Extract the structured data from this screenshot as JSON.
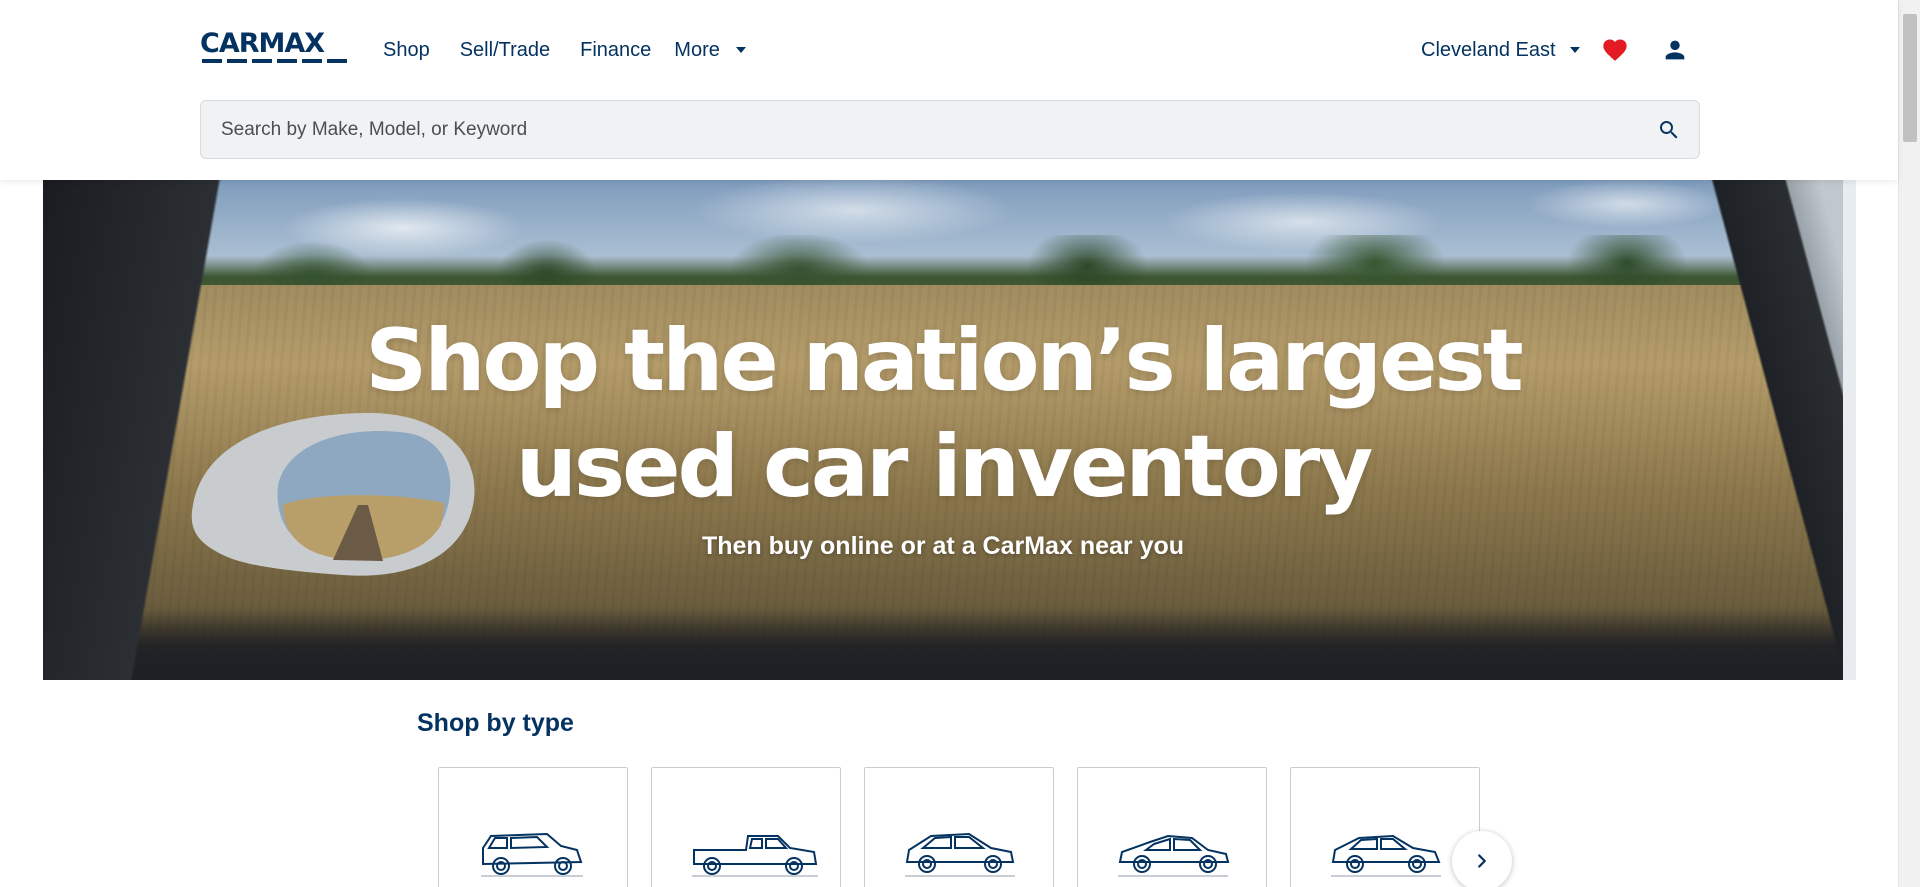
{
  "header": {
    "logo_text": "CARMAX",
    "nav": [
      {
        "label": "Shop"
      },
      {
        "label": "Sell/Trade"
      },
      {
        "label": "Finance"
      },
      {
        "label": "More"
      }
    ],
    "store": "Cleveland East",
    "favorites_icon": "heart-icon",
    "account_icon": "user-icon"
  },
  "search": {
    "placeholder": "Search by Make, Model, or Keyword",
    "value": ""
  },
  "hero": {
    "title_line1": "Shop the nation’s largest",
    "title_line2": "used car inventory",
    "subtitle": "Then buy online or at a CarMax near you"
  },
  "shop_by_type": {
    "title": "Shop by type",
    "cards": [
      {
        "icon": "suv-icon"
      },
      {
        "icon": "truck-icon"
      },
      {
        "icon": "crossover-icon"
      },
      {
        "icon": "sedan-icon"
      },
      {
        "icon": "hatchback-icon"
      }
    ],
    "next_icon": "chevron-right-icon"
  },
  "colors": {
    "brand_navy": "#053361",
    "heart_red": "#e31b23",
    "search_bg": "#f0f2f4"
  }
}
